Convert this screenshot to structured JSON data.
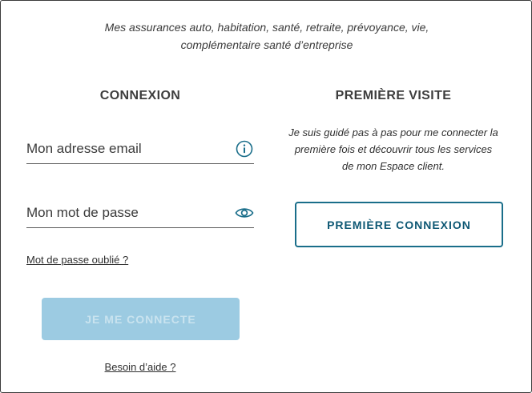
{
  "tagline": {
    "line1": "Mes assurances auto, habitation, santé, retraite, prévoyance, vie,",
    "line2": "complémentaire santé d’entreprise"
  },
  "login": {
    "heading": "CONNEXION",
    "email_placeholder": "Mon adresse email",
    "email_icon": "info-icon",
    "password_placeholder": "Mon mot de passe",
    "password_icon": "eye-icon",
    "forgot_link": "Mot de passe oublié ?",
    "submit_label": "JE ME CONNECTE",
    "help_link": "Besoin d’aide ?"
  },
  "first_visit": {
    "heading": "PREMIÈRE VISITE",
    "text_line1": "Je suis guidé pas à pas pour me connecter la",
    "text_line2": "première fois et découvrir tous les services",
    "text_line3": "de mon Espace client.",
    "button_label": "PREMIÈRE CONNEXION"
  },
  "colors": {
    "primary": "#0e5874",
    "disabled_button": "#9ccbe2",
    "icon": "#1a6e8a"
  }
}
